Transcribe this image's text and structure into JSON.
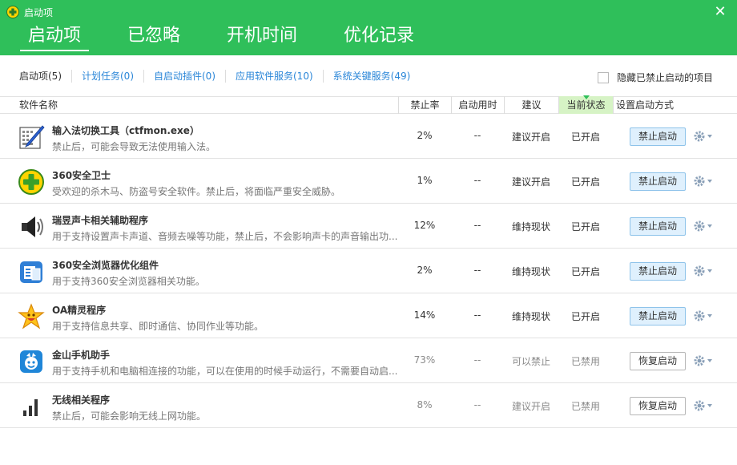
{
  "window": {
    "title": "启动项",
    "close_glyph": "✕"
  },
  "tabs": [
    {
      "label": "启动项",
      "active": true
    },
    {
      "label": "已忽略",
      "active": false
    },
    {
      "label": "开机时间",
      "active": false
    },
    {
      "label": "优化记录",
      "active": false
    }
  ],
  "subtabs": [
    {
      "label": "启动项(5)",
      "active": true
    },
    {
      "label": "计划任务(0)",
      "active": false
    },
    {
      "label": "自启动插件(0)",
      "active": false
    },
    {
      "label": "应用软件服务(10)",
      "active": false
    },
    {
      "label": "系统关键服务(49)",
      "active": false
    }
  ],
  "hide_disabled": {
    "label": "隐藏已禁止启动的项目",
    "checked": false
  },
  "columns": {
    "name": "软件名称",
    "rate": "禁止率",
    "time": "启动用时",
    "suggest": "建议",
    "state": "当前状态",
    "setting": "设置启动方式"
  },
  "rows": [
    {
      "icon": "ime-pen-icon",
      "name": "输入法切换工具（ctfmon.exe）",
      "desc": "禁止后，可能会导致无法使用输入法。",
      "rate": "2%",
      "time": "--",
      "suggest": "建议开启",
      "state": "已开启",
      "action": "禁止启动",
      "action_type": "disable"
    },
    {
      "icon": "360-guard-icon",
      "name": "360安全卫士",
      "desc": "受欢迎的杀木马、防盗号安全软件。禁止后，将面临严重安全威胁。",
      "rate": "1%",
      "time": "--",
      "suggest": "建议开启",
      "state": "已开启",
      "action": "禁止启动",
      "action_type": "disable"
    },
    {
      "icon": "speaker-icon",
      "name": "瑞昱声卡相关辅助程序",
      "desc": "用于支持设置声卡声道、音频去噪等功能，禁止后，不会影响声卡的声音输出功...",
      "rate": "12%",
      "time": "--",
      "suggest": "维持现状",
      "state": "已开启",
      "action": "禁止启动",
      "action_type": "disable"
    },
    {
      "icon": "browser-component-icon",
      "name": "360安全浏览器优化组件",
      "desc": "用于支持360安全浏览器相关功能。",
      "rate": "2%",
      "time": "--",
      "suggest": "维持现状",
      "state": "已开启",
      "action": "禁止启动",
      "action_type": "disable"
    },
    {
      "icon": "star-face-icon",
      "name": "OA精灵程序",
      "desc": "用于支持信息共享、即时通信、协同作业等功能。",
      "rate": "14%",
      "time": "--",
      "suggest": "维持现状",
      "state": "已开启",
      "action": "禁止启动",
      "action_type": "disable"
    },
    {
      "icon": "phone-assistant-icon",
      "name": "金山手机助手",
      "desc": "用于支持手机和电脑相连接的功能，可以在使用的时候手动运行，不需要自动启...",
      "rate": "73%",
      "time": "--",
      "suggest": "可以禁止",
      "state": "已禁用",
      "action": "恢复启动",
      "action_type": "restore"
    },
    {
      "icon": "wifi-bars-icon",
      "name": "无线相关程序",
      "desc": "禁止后，可能会影响无线上网功能。",
      "rate": "8%",
      "time": "--",
      "suggest": "建议开启",
      "state": "已禁用",
      "action": "恢复启动",
      "action_type": "restore"
    }
  ],
  "colors": {
    "header_green": "#2fbf5a",
    "link_blue": "#2a86d8",
    "state_col_bg": "#d6f3c5"
  }
}
